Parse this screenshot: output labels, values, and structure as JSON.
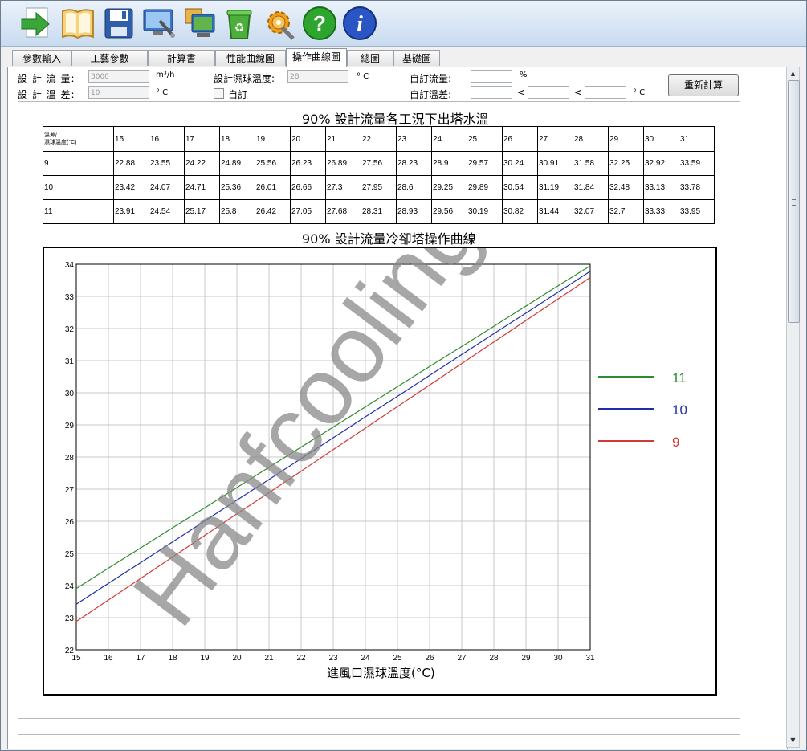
{
  "toolbar": {
    "icons": [
      "arrow-right-icon",
      "book-icon",
      "save-icon",
      "monitor-tools-icon",
      "computer-icon",
      "recycle-icon",
      "gear-wrench-icon",
      "help-icon",
      "info-icon"
    ]
  },
  "tabs": [
    {
      "label": "參數輸入",
      "active": false
    },
    {
      "label": "工藝參數",
      "active": false
    },
    {
      "label": "計算書",
      "active": false
    },
    {
      "label": "性能曲線圖",
      "active": false
    },
    {
      "label": "操作曲線圖",
      "active": true
    },
    {
      "label": "總圖",
      "active": false
    },
    {
      "label": "基礎圖",
      "active": false
    }
  ],
  "form": {
    "design_flow_label": "設 計 流 量:",
    "design_flow_value": "3000",
    "design_flow_unit": "m³/h",
    "design_temp_diff_label": "設 計 溫 差:",
    "design_temp_diff_value": "10",
    "design_temp_diff_unit": "° C",
    "wet_bulb_label": "設計濕球溫度:",
    "wet_bulb_value": "28",
    "wet_bulb_unit": "° C",
    "custom_checkbox_label": "自訂",
    "custom_flow_label": "自訂流量:",
    "custom_flow_value": "",
    "custom_flow_unit": "%",
    "custom_temp_diff_label": "自訂溫差:",
    "custom_temp_diff_lt1": "<",
    "custom_temp_diff_lt2": "<",
    "custom_temp_diff_unit": "° C",
    "recalc_button": "重新計算"
  },
  "table": {
    "title": "90% 設計流量各工況下出塔水溫",
    "corner_line1": "溫差/",
    "corner_line2": "濕球溫度(°C)",
    "columns": [
      "15",
      "16",
      "17",
      "18",
      "19",
      "20",
      "21",
      "22",
      "23",
      "24",
      "25",
      "26",
      "27",
      "28",
      "29",
      "30",
      "31"
    ],
    "rows": [
      {
        "label": "9",
        "values": [
          "22.88",
          "23.55",
          "24.22",
          "24.89",
          "25.56",
          "26.23",
          "26.89",
          "27.56",
          "28.23",
          "28.9",
          "29.57",
          "30.24",
          "30.91",
          "31.58",
          "32.25",
          "32.92",
          "33.59"
        ]
      },
      {
        "label": "10",
        "values": [
          "23.42",
          "24.07",
          "24.71",
          "25.36",
          "26.01",
          "26.66",
          "27.3",
          "27.95",
          "28.6",
          "29.25",
          "29.89",
          "30.54",
          "31.19",
          "31.84",
          "32.48",
          "33.13",
          "33.78"
        ]
      },
      {
        "label": "11",
        "values": [
          "23.91",
          "24.54",
          "25.17",
          "25.8",
          "26.42",
          "27.05",
          "27.68",
          "28.31",
          "28.93",
          "29.56",
          "30.19",
          "30.82",
          "31.44",
          "32.07",
          "32.7",
          "33.33",
          "33.95"
        ]
      }
    ]
  },
  "chart_data": {
    "type": "line",
    "title": "90% 設計流量冷卻塔操作曲線",
    "xlabel": "進風口濕球溫度(°C)",
    "ylabel": "",
    "x": [
      15,
      16,
      17,
      18,
      19,
      20,
      21,
      22,
      23,
      24,
      25,
      26,
      27,
      28,
      29,
      30,
      31
    ],
    "xlim": [
      15,
      31
    ],
    "ylim": [
      22,
      34
    ],
    "xticks": [
      "15",
      "16",
      "17",
      "18",
      "19",
      "20",
      "21",
      "22",
      "23",
      "24",
      "25",
      "26",
      "27",
      "28",
      "29",
      "30",
      "31"
    ],
    "yticks": [
      "22",
      "23",
      "24",
      "25",
      "26",
      "27",
      "28",
      "29",
      "30",
      "31",
      "32",
      "33",
      "34"
    ],
    "grid": true,
    "legend": "right",
    "series": [
      {
        "name": "11",
        "color": "#2e8b2e",
        "values": [
          23.91,
          24.54,
          25.17,
          25.8,
          26.42,
          27.05,
          27.68,
          28.31,
          28.93,
          29.56,
          30.19,
          30.82,
          31.44,
          32.07,
          32.7,
          33.33,
          33.95
        ]
      },
      {
        "name": "10",
        "color": "#1f2fa8",
        "values": [
          23.42,
          24.07,
          24.71,
          25.36,
          26.01,
          26.66,
          27.3,
          27.95,
          28.6,
          29.25,
          29.89,
          30.54,
          31.19,
          31.84,
          32.48,
          33.13,
          33.78
        ]
      },
      {
        "name": "9",
        "color": "#d23a3a",
        "values": [
          22.88,
          23.55,
          24.22,
          24.89,
          25.56,
          26.23,
          26.89,
          27.56,
          28.23,
          28.9,
          29.57,
          30.24,
          30.91,
          31.58,
          32.25,
          32.92,
          33.59
        ]
      }
    ]
  },
  "watermark": "Hanfcooling"
}
